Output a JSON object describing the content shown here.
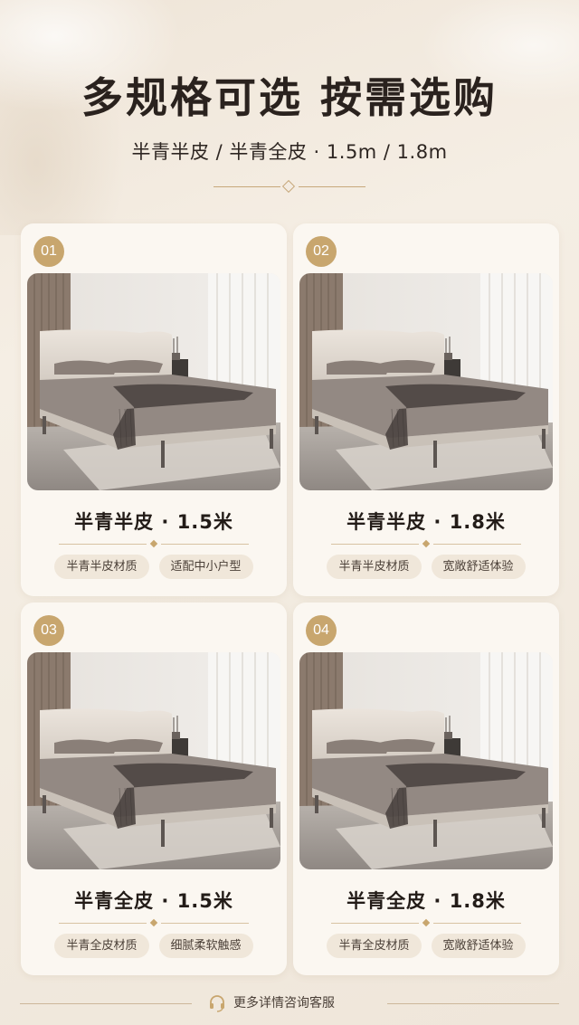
{
  "header": {
    "title": "多规格可选 按需选购",
    "subtitle": "半青半皮 / 半青全皮 · 1.5m / 1.8m"
  },
  "colors": {
    "accent": "#c8a66e",
    "tag_bg": "#f0e7da",
    "card_bg": "#fbf7f1"
  },
  "cards": [
    {
      "number": "01",
      "name": "半青半皮 · 1.5米",
      "tags": [
        "半青半皮材质",
        "适配中小户型"
      ],
      "image": "bed-photo"
    },
    {
      "number": "02",
      "name": "半青半皮 · 1.8米",
      "tags": [
        "半青半皮材质",
        "宽敞舒适体验"
      ],
      "image": "bed-photo"
    },
    {
      "number": "03",
      "name": "半青全皮 · 1.5米",
      "tags": [
        "半青全皮材质",
        "细腻柔软触感"
      ],
      "image": "bed-photo"
    },
    {
      "number": "04",
      "name": "半青全皮 · 1.8米",
      "tags": [
        "半青全皮材质",
        "宽敞舒适体验"
      ],
      "image": "bed-photo"
    }
  ],
  "footer": {
    "icon": "headset-icon",
    "text": "更多详情咨询客服"
  }
}
